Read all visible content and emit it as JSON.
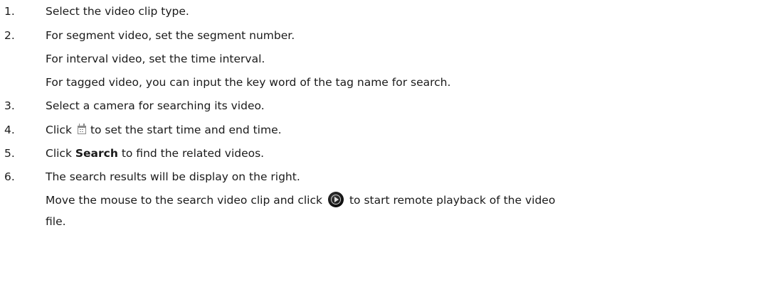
{
  "steps": [
    {
      "num": "1.",
      "text": "Select the video clip type."
    },
    {
      "num": "2.",
      "text": "For segment video, set the segment number."
    },
    {
      "text": "For interval video, set the time interval."
    },
    {
      "text": "For tagged video, you can input the key word of the tag name for search."
    },
    {
      "num": "3.",
      "text": "Select a camera for searching its video."
    },
    {
      "num": "4.",
      "text_before": "Click",
      "icon": "calendar-icon",
      "text_after": "to set the start time and end time."
    },
    {
      "num": "5.",
      "text_before": "Click ",
      "bold": "Search",
      "text_after": " to find the related videos."
    },
    {
      "num": "6.",
      "text": "The search results will be display on the right."
    },
    {
      "text_before": "Move the mouse to the search video clip and click",
      "icon": "play-icon",
      "text_after": "to start remote playback of the video"
    },
    {
      "text": "file."
    }
  ]
}
